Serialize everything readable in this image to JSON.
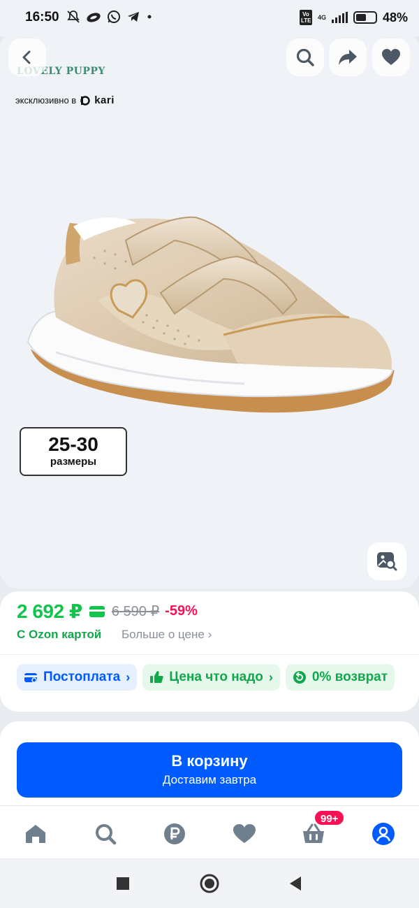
{
  "status_bar": {
    "time": "16:50",
    "network_badge": "Vo LTE",
    "network_type": "4G",
    "battery_percent": "48%",
    "battery_level": 0.48,
    "icons": [
      "muted-bell-icon",
      "cloud-icon",
      "whatsapp-icon",
      "telegram-icon",
      "dot-icon"
    ]
  },
  "product": {
    "brand": "LOVELY PUPPY",
    "exclusive_text": "эксклюзивно в",
    "exclusive_store": "kari",
    "size_range": "25-30",
    "size_label": "размеры"
  },
  "header_actions": [
    "back-icon",
    "search-icon",
    "share-icon",
    "heart-icon"
  ],
  "price": {
    "current": "2 692 ₽",
    "old": "6 590 ₽",
    "discount": "-59%",
    "card_label": "С Ozon картой",
    "more_link": "Больше о цене"
  },
  "chips": [
    {
      "label": "Постоплата",
      "icon": "wallet-icon"
    },
    {
      "label": "Цена что надо",
      "icon": "thumbs-up-icon"
    },
    {
      "label": "0% возврат",
      "icon": "return-icon"
    }
  ],
  "cart": {
    "title": "В корзину",
    "subtitle": "Доставим завтра"
  },
  "bottom_nav": {
    "items": [
      "home-icon",
      "search-icon",
      "ruble-icon",
      "heart-icon",
      "basket-icon",
      "profile-icon"
    ],
    "cart_badge": "99+"
  },
  "colors": {
    "price_green": "#10c44c",
    "discount_red": "#f91155",
    "ozon_blue": "#005bff"
  }
}
